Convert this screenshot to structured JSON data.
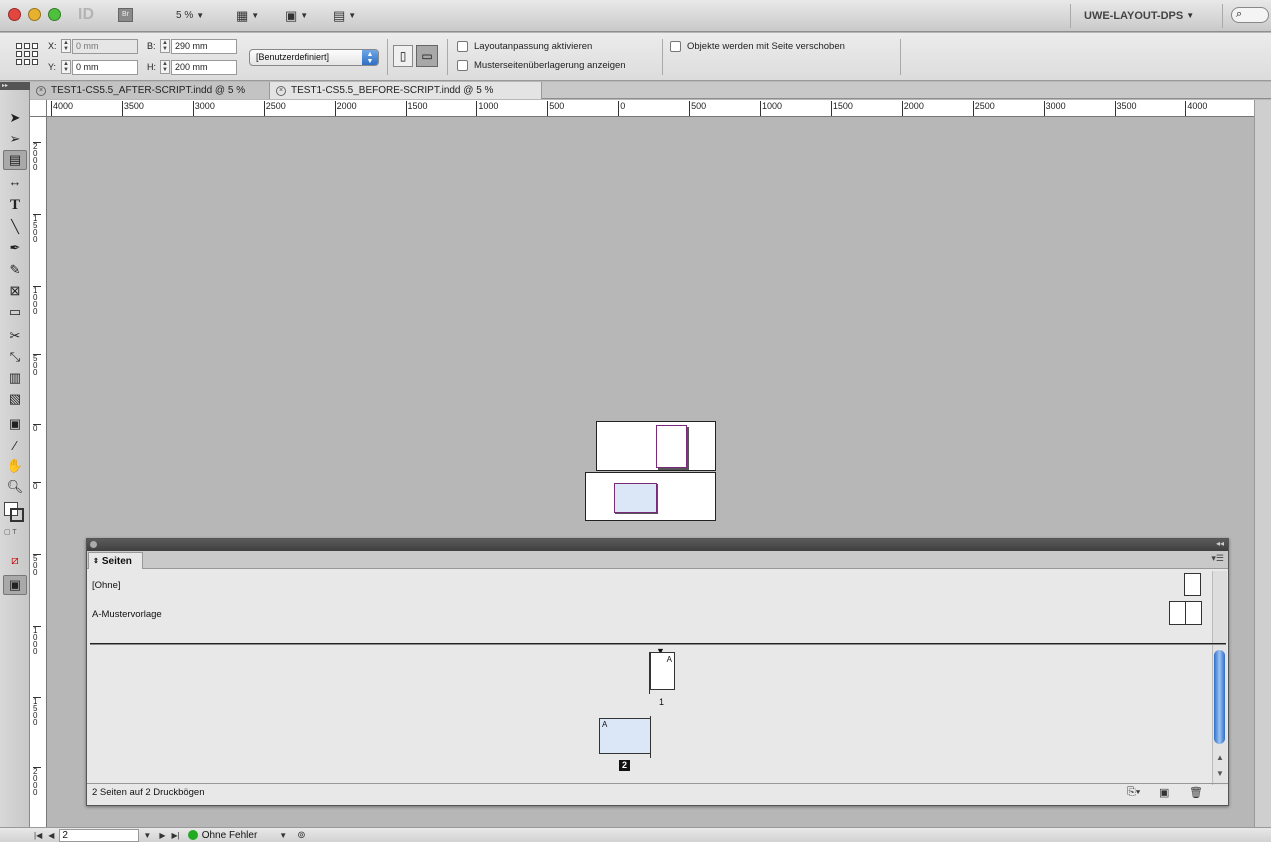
{
  "app": {
    "logo": "ID",
    "bridge_label": "Br",
    "zoom": "5 %",
    "workspace": "UWE-LAYOUT-DPS"
  },
  "control": {
    "x_label": "X:",
    "x_value": "0 mm",
    "y_label": "Y:",
    "y_value": "0 mm",
    "w_label": "B:",
    "w_value": "290 mm",
    "h_label": "H:",
    "h_value": "200 mm",
    "preset": "[Benutzerdefiniert]",
    "cb1": "Layoutanpassung aktivieren",
    "cb2": "Musterseitenüberlagerung anzeigen",
    "cb3": "Objekte werden mit Seite verschoben"
  },
  "tabs": [
    {
      "label": "TEST1-CS5.5_AFTER-SCRIPT.indd @ 5 %",
      "active": false
    },
    {
      "label": "TEST1-CS5.5_BEFORE-SCRIPT.indd @ 5 %",
      "active": true
    }
  ],
  "ruler": {
    "h_ticks": [
      "4000",
      "3500",
      "3000",
      "2500",
      "2000",
      "1500",
      "1000",
      "500",
      "0",
      "500",
      "1000",
      "1500",
      "2000",
      "2500",
      "3000",
      "3500",
      "4000"
    ],
    "v_ticks": [
      "2\n0\n0\n0",
      "1\n5\n0\n0",
      "1\n0\n0\n0",
      "5\n0\n0",
      "0",
      "0",
      "5\n0\n0",
      "1\n0\n0\n0",
      "1\n5\n0\n0",
      "2\n0\n0\n0"
    ]
  },
  "pages_panel": {
    "title": "Seiten",
    "masters": [
      "[Ohne]",
      "A-Mustervorlage"
    ],
    "page1_number": "1",
    "page1_prefix": "A",
    "page2_number": "2",
    "page2_prefix": "A",
    "status": "2 Seiten auf 2 Druckbögen"
  },
  "statusbar": {
    "page": "2",
    "preflight": "Ohne Fehler",
    "preflight_color": "#22aa22"
  }
}
